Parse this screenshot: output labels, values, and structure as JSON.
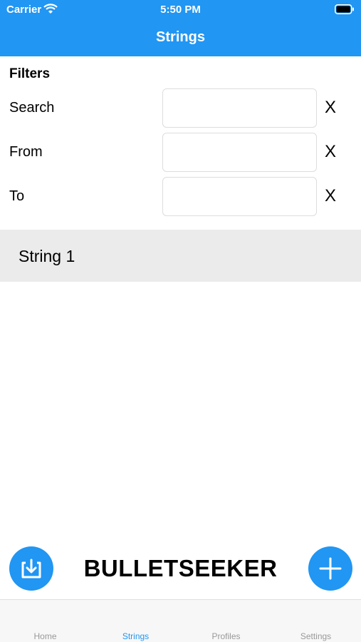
{
  "status_bar": {
    "carrier": "Carrier",
    "time": "5:50 PM"
  },
  "nav": {
    "title": "Strings"
  },
  "filters": {
    "title": "Filters",
    "rows": [
      {
        "label": "Search",
        "value": "",
        "placeholder": "",
        "clear_label": "X"
      },
      {
        "label": "From",
        "value": "",
        "placeholder": "",
        "clear_label": "X"
      },
      {
        "label": "To",
        "value": "",
        "placeholder": "",
        "clear_label": "X"
      }
    ]
  },
  "list": {
    "items": [
      {
        "label": "String 1"
      }
    ]
  },
  "footer": {
    "brand": "BULLETSEEKER",
    "import_icon": "import-icon",
    "add_icon": "plus-icon"
  },
  "tabbar": {
    "items": [
      {
        "label": "Home"
      },
      {
        "label": "Strings",
        "active": true
      },
      {
        "label": "Profiles"
      },
      {
        "label": "Settings"
      }
    ]
  },
  "colors": {
    "accent": "#2196f3",
    "list_item_bg": "#ebebeb",
    "tab_inactive": "#999999"
  }
}
